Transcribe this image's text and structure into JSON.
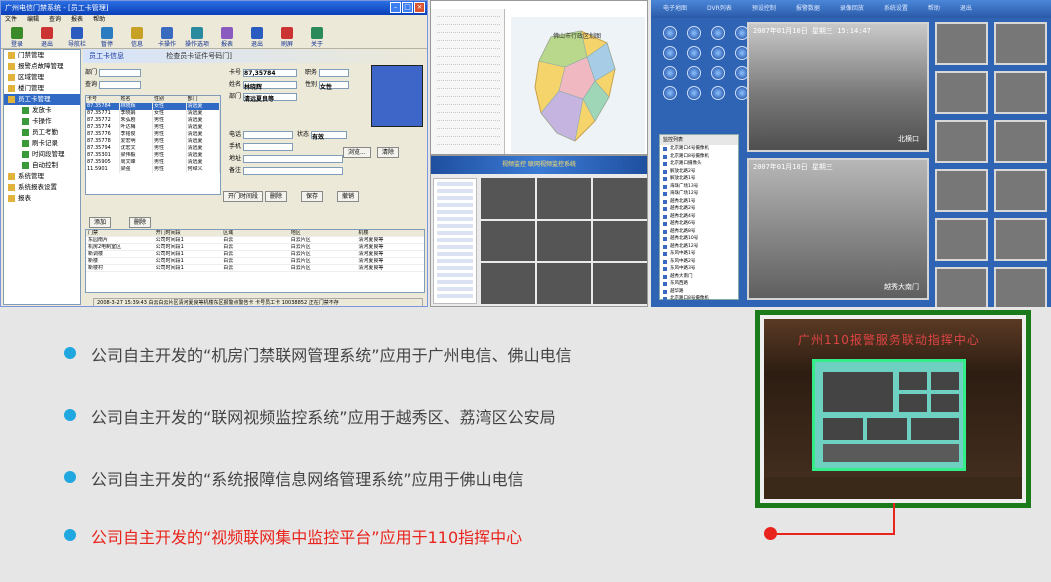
{
  "access_app": {
    "title": "广州电信门禁系统 - [员工卡管理]",
    "menu": [
      "文件",
      "编辑",
      "查询",
      "报表",
      "帮助"
    ],
    "toolbar": [
      "登录",
      "退出",
      "导航栏",
      "暂停",
      "信息",
      "卡操作",
      "操作选项",
      "报表",
      "退出",
      "刷屏",
      "关于"
    ],
    "tree": [
      {
        "label": "门禁管理",
        "level": 0
      },
      {
        "label": "报警点故障管理",
        "level": 0
      },
      {
        "label": "区域管理",
        "level": 0
      },
      {
        "label": "楼门管理",
        "level": 0
      },
      {
        "label": "员工卡管理",
        "level": 0,
        "selected": true
      },
      {
        "label": "发放卡",
        "level": 1
      },
      {
        "label": "卡操作",
        "level": 1
      },
      {
        "label": "员工考勤",
        "level": 1
      },
      {
        "label": "刷卡记录",
        "level": 1
      },
      {
        "label": "时间段管理",
        "level": 1
      },
      {
        "label": "自动控制",
        "level": 1
      },
      {
        "label": "系统管理",
        "level": 0
      },
      {
        "label": "系统报表设置",
        "level": 0
      },
      {
        "label": "报表",
        "level": 0
      }
    ],
    "card_title": "员工卡信息",
    "card_subtitle": "检查员卡证件号码门]",
    "fields": {
      "dept": "部门",
      "search": "查询",
      "card_no": "卡号",
      "card_no_val": "87,35784",
      "name": "姓名",
      "name_val": "林晓辉",
      "sex": "性别",
      "sex_val": "女性",
      "dept_val": "清远夏良等",
      "title": "职务",
      "status": "状态",
      "status_val": "有效",
      "phone": "电话",
      "mobile": "手机",
      "addr": "地址",
      "note": "备注"
    },
    "grid_header": [
      "卡号",
      "姓名",
      "性别",
      "部门"
    ],
    "grid_rows": [
      [
        "87.35784",
        "林晓辉",
        "女性",
        "清远夏"
      ],
      [
        "87.35771",
        "李晓娟",
        "女性",
        "清远夏"
      ],
      [
        "87.35772",
        "朱弘剧",
        "男性",
        "清远夏"
      ],
      [
        "87.35774",
        "叶达梅",
        "男性",
        "清远夏"
      ],
      [
        "87.35776",
        "李铭俊",
        "男性",
        "清远夏"
      ],
      [
        "87.35778",
        "爱宏明",
        "男性",
        "清远夏"
      ],
      [
        "87.35794",
        "沈宏文",
        "男性",
        "清远夏"
      ],
      [
        "87.35301",
        "梁伟毅",
        "男性",
        "清远夏"
      ],
      [
        "87.35905",
        "周文峰",
        "男性",
        "清远夏"
      ],
      [
        "11.5901",
        "梁强",
        "男性",
        "何绰义"
      ]
    ],
    "buttons": {
      "add": "添加",
      "del": "删除",
      "save": "保存",
      "cancel": "撤销",
      "open": "开门时间段",
      "browse": "浏览...",
      "clear": "清除"
    },
    "door_header": [
      "门禁",
      "开门时间段",
      "区域",
      "地区",
      "机楼"
    ],
    "door_rows": [
      [
        "东园南片",
        "公司时间段1",
        "白云",
        "白云片区",
        "清河夏良等"
      ],
      [
        "机房2电制室区",
        "公司时间段1",
        "白云",
        "白云片区",
        "清河夏良等"
      ],
      [
        "新调楼",
        "公司时间段1",
        "白云",
        "白云片区",
        "清河夏良等"
      ],
      [
        "新楼",
        "公司时间段1",
        "白云",
        "白云片区",
        "清河夏良等"
      ],
      [
        "新楼村",
        "公司时间段1",
        "白云",
        "白云片区",
        "清河夏良等"
      ]
    ],
    "status_text": "2008-3-27 15:39:43 白云白云片区清河夏良等机楼东区报警点警告卡 卡号员工卡 10038852 正在门禁不存"
  },
  "gis_app": {
    "map_title": "佛山市行政区划图"
  },
  "video_app": {
    "banner": "视频监控 联网视频监控系统"
  },
  "video_wall": {
    "nav": [
      "电子地图",
      "DVR列表",
      "预设控制",
      "报警数据",
      "录像回放",
      "系统设置",
      "帮助",
      "退出"
    ],
    "cam_list_title": "监控列表",
    "cam_list": [
      "北京路口4号摄像机",
      "北京路口8号摄像机",
      "北京路口摄像头",
      "解放北路2号",
      "解放北路1号",
      "海珠广场13号",
      "海珠广场12号",
      "越秀北路1号",
      "越秀北路2号",
      "越秀北路4号",
      "越秀北路6号",
      "越秀北路8号",
      "越秀北路10号",
      "越秀北路12号",
      "东风中路1号",
      "东风中路2号",
      "东风中路3号",
      "越秀大南门",
      "东风西路",
      "越华路",
      "北京路口8号摄像机"
    ],
    "cam1_time": "2007年01月10日 星期三 15:14:47",
    "cam1_label": "北横口",
    "cam2_time": "2007年01月10日 星期三",
    "cam2_label": "越秀大南门"
  },
  "bullets": [
    {
      "text": "公司自主开发的“机房门禁联网管理系统”应用于广州电信、佛山电信",
      "highlight": false
    },
    {
      "text": "公司自主开发的“联网视频监控系统”应用于越秀区、荔湾区公安局",
      "highlight": false
    },
    {
      "text": "公司自主开发的“系统报障信息网络管理系统”应用于佛山电信",
      "highlight": false
    },
    {
      "text": "公司自主开发的“视频联网集中监控平台”应用于110指挥中心",
      "highlight": true
    }
  ],
  "photo_title": "广州110报警服务联动指挥中心",
  "colors": {
    "bullet_dot": "#20a7e0",
    "highlight": "#e8241c",
    "text": "#444444",
    "frame": "#1b7b1b"
  }
}
